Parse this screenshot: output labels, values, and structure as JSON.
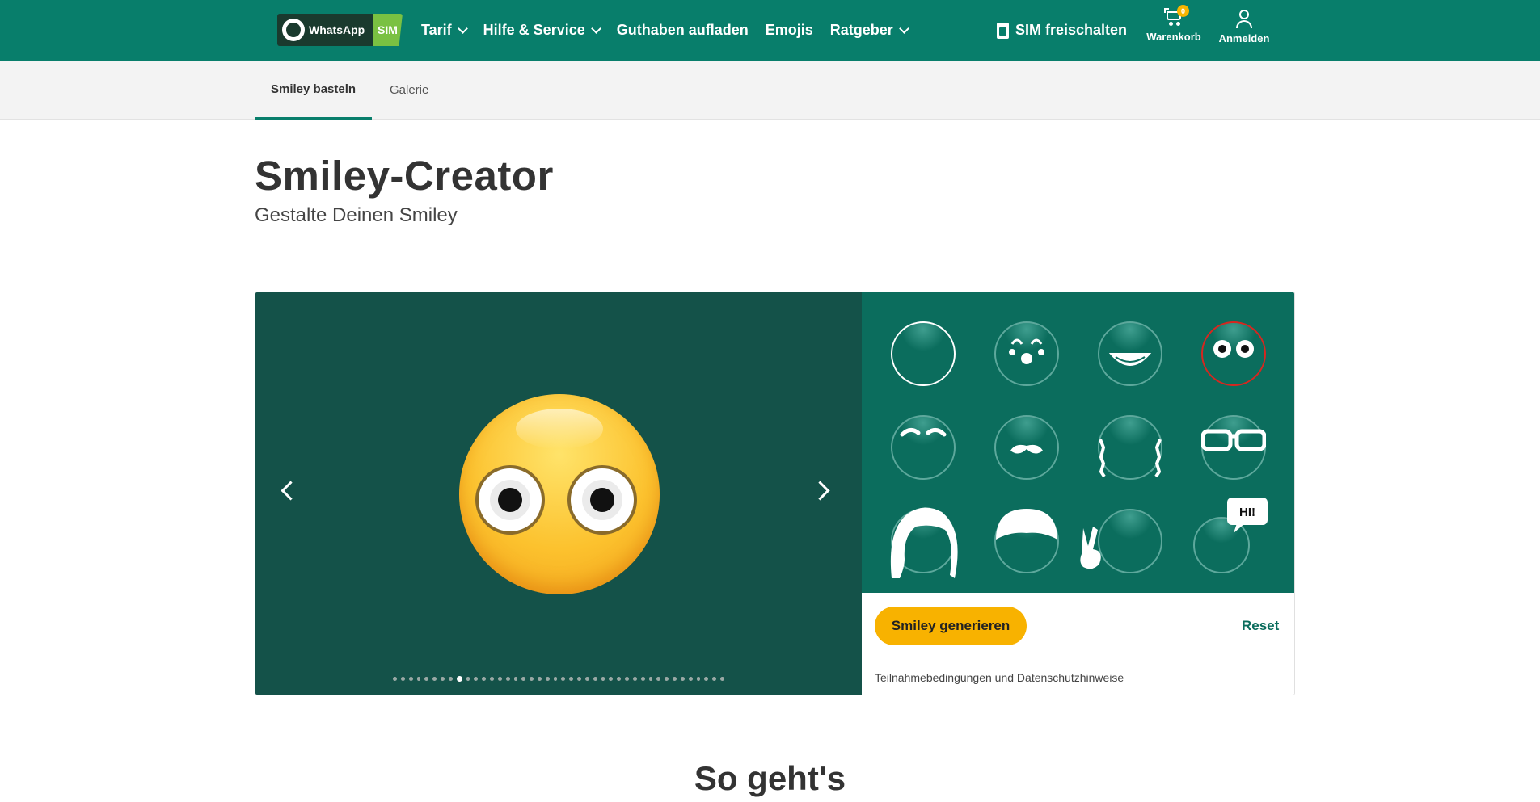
{
  "header": {
    "logo": {
      "brand": "WhatsApp",
      "badge": "SIM"
    },
    "nav": [
      {
        "label": "Tarif",
        "dropdown": true
      },
      {
        "label": "Hilfe & Service",
        "dropdown": true
      },
      {
        "label": "Guthaben aufladen",
        "dropdown": false
      },
      {
        "label": "Emojis",
        "dropdown": false
      },
      {
        "label": "Ratgeber",
        "dropdown": true
      }
    ],
    "sim_unlock": "SIM freischalten",
    "cart": {
      "label": "Warenkorb",
      "count": "0"
    },
    "login": {
      "label": "Anmelden"
    }
  },
  "subnav": {
    "tabs": [
      "Smiley basteln",
      "Galerie"
    ],
    "active": 0
  },
  "page": {
    "title": "Smiley-Creator",
    "subtitle": "Gestalte Deinen Smiley"
  },
  "creator": {
    "carousel": {
      "total_dots": 42,
      "active_dot": 8
    },
    "options": [
      {
        "name": "base-face",
        "icon": "plain-face-icon"
      },
      {
        "name": "clown",
        "icon": "clown-face-icon"
      },
      {
        "name": "grin",
        "icon": "grin-mouth-icon"
      },
      {
        "name": "goggle-eyes",
        "icon": "goggle-eyes-icon",
        "selected": true
      },
      {
        "name": "eyebrows",
        "icon": "eyebrows-icon"
      },
      {
        "name": "mustache",
        "icon": "mustache-icon"
      },
      {
        "name": "pigtails",
        "icon": "pigtails-icon"
      },
      {
        "name": "glasses",
        "icon": "glasses-icon"
      },
      {
        "name": "long-hair",
        "icon": "long-hair-icon"
      },
      {
        "name": "cap",
        "icon": "cap-icon"
      },
      {
        "name": "peace-hand",
        "icon": "peace-hand-icon"
      },
      {
        "name": "hi-bubble",
        "icon": "speech-bubble-icon",
        "text": "HI!"
      }
    ],
    "generate_label": "Smiley generieren",
    "reset_label": "Reset",
    "terms": "Teilnahmebedingungen und Datenschutzhinweise"
  },
  "section": {
    "title": "So geht's"
  },
  "colors": {
    "primary": "#087e6b",
    "stage": "#145249",
    "panel": "#0b6d5d",
    "accent": "#f8b200",
    "selected": "#d8261f"
  }
}
